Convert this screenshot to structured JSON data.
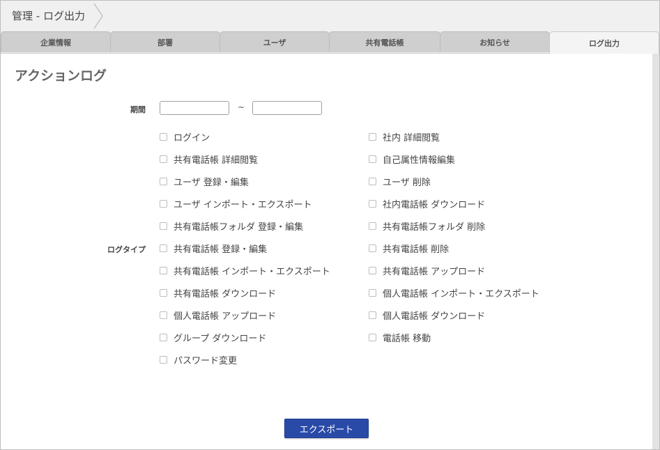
{
  "header": {
    "breadcrumb": "管理 - ログ出力"
  },
  "tabs": [
    {
      "label": "企業情報",
      "active": false
    },
    {
      "label": "部署",
      "active": false
    },
    {
      "label": "ユーザ",
      "active": false
    },
    {
      "label": "共有電話帳",
      "active": false
    },
    {
      "label": "お知らせ",
      "active": false
    },
    {
      "label": "ログ出力",
      "active": true
    }
  ],
  "main": {
    "title": "アクションログ",
    "period_label": "期間",
    "period_separator": "~",
    "period_from": "",
    "period_to": "",
    "logtype_label": "ログタイプ",
    "left_options": [
      "ログイン",
      "共有電話帳 詳細閲覧",
      "ユーザ 登録・編集",
      "ユーザ インポート・エクスポート",
      "共有電話帳フォルダ 登録・編集",
      "共有電話帳 登録・編集",
      "共有電話帳 インポート・エクスポート",
      "共有電話帳 ダウンロード",
      "個人電話帳 アップロード",
      "グループ ダウンロード",
      "パスワード変更"
    ],
    "right_options": [
      "社内 詳細閲覧",
      "自己属性情報編集",
      "ユーザ 削除",
      "社内電話帳 ダウンロード",
      "共有電話帳フォルダ 削除",
      "共有電話帳 削除",
      "共有電話帳 アップロード",
      "個人電話帳 インポート・エクスポート",
      "個人電話帳 ダウンロード",
      "電話帳 移動"
    ],
    "export_label": "エクスポート"
  },
  "colors": {
    "accent": "#2a4aa8",
    "tab_bg": "#cfcfcf",
    "active_tab_bg": "#f4f4f4"
  },
  "icons": {
    "breadcrumb_separator": "chevron-right-icon",
    "checkbox": "checkbox-icon"
  }
}
